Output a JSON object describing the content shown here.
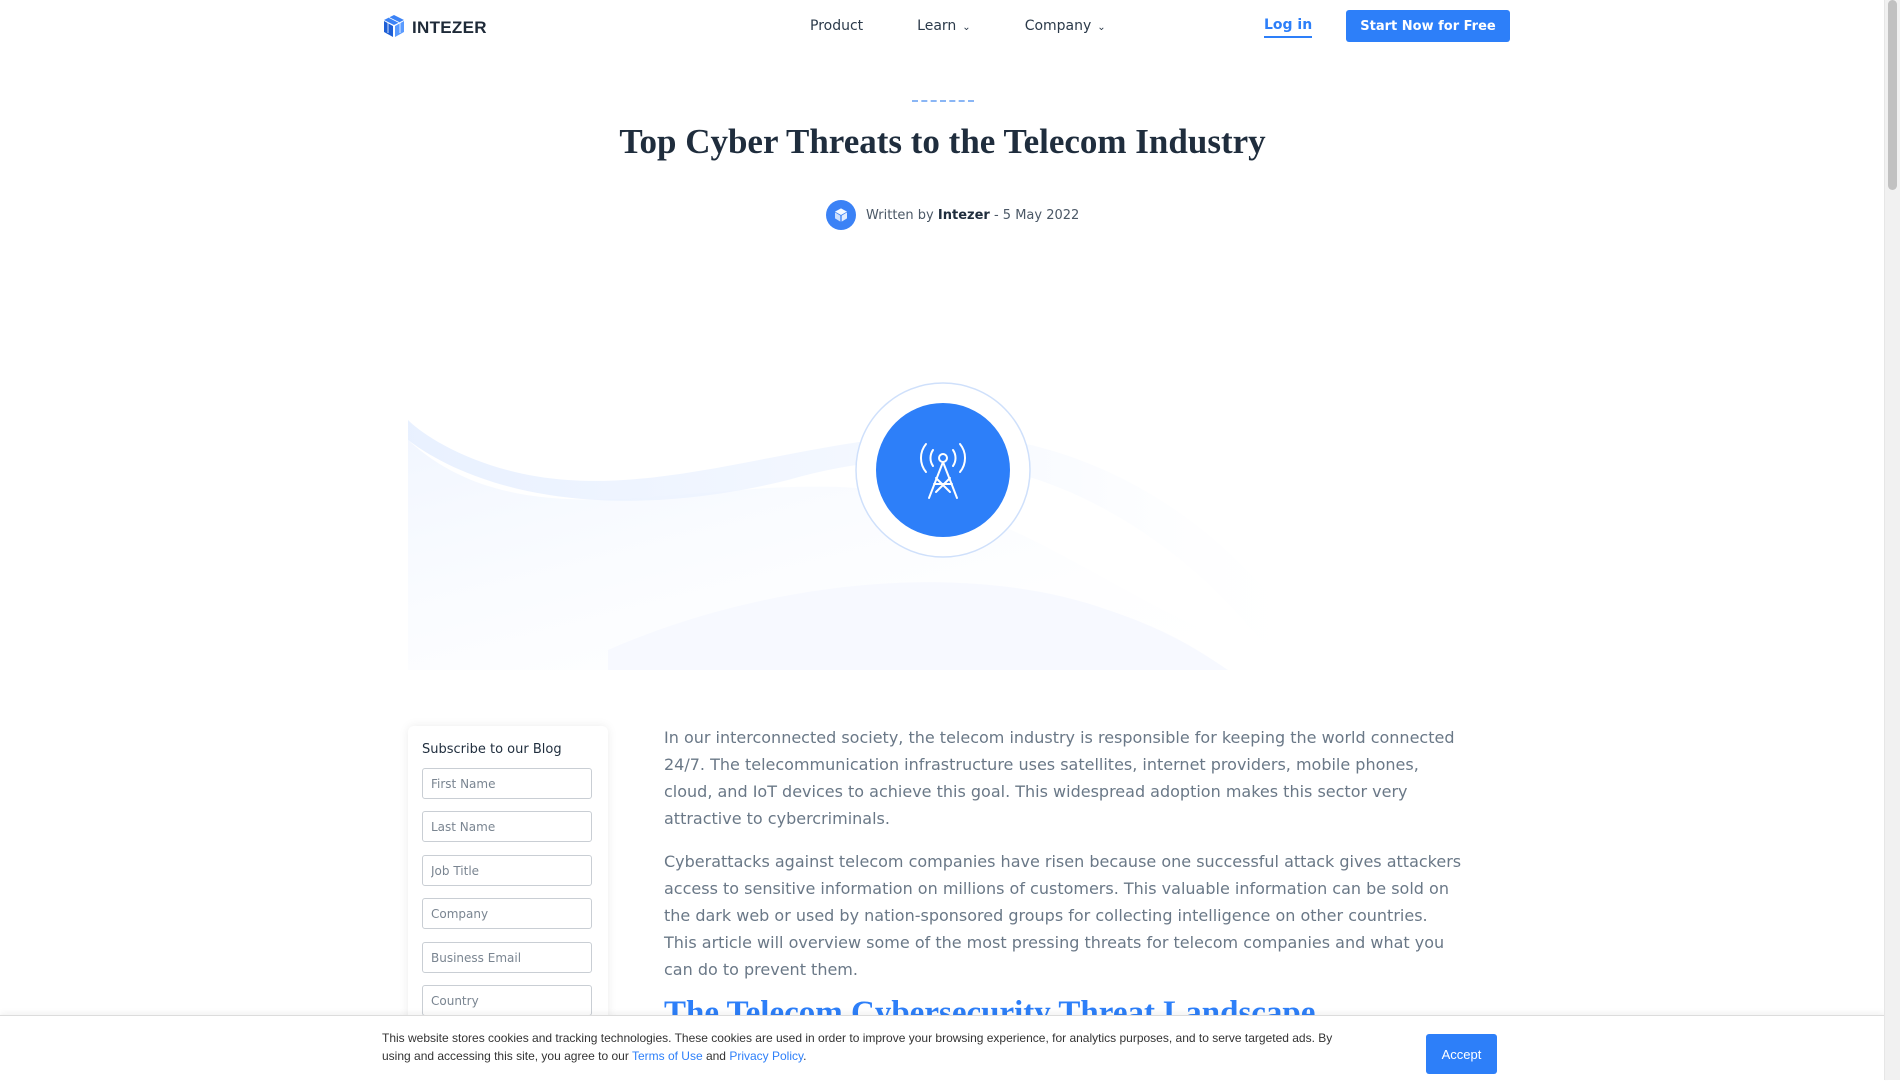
{
  "header": {
    "logo_text": "INTEZER",
    "nav": [
      {
        "label": "Product"
      },
      {
        "label": "Learn"
      },
      {
        "label": "Company"
      }
    ],
    "login_label": "Log in",
    "cta_label": "Start Now for Free"
  },
  "post": {
    "title": "Top Cyber Threats to the Telecom Industry",
    "written_by": "Written by",
    "author": "Intezer",
    "separator": "-",
    "date": "5 May 2022"
  },
  "subscribe": {
    "heading": "Subscribe to our Blog",
    "fields": {
      "first_name": "First Name",
      "last_name": "Last Name",
      "job_title": "Job Title",
      "company": "Company",
      "email": "Business Email",
      "country": "Country"
    }
  },
  "article": {
    "paragraphs": [
      "In our interconnected society, the telecom industry is responsible for keeping the world connected 24/7. The telecommunication infrastructure uses satellites, internet providers, mobile phones, cloud, and IoT devices to achieve this goal. This widespread adoption makes this sector very attractive to cybercriminals.",
      "Cyberattacks against telecom companies have risen because one successful attack gives attackers access to sensitive information on millions of customers. This valuable information can be sold on the dark web or used by nation-sponsored groups for collecting intelligence on other countries. This article will overview some of the most pressing threats for telecom companies and what you can do to prevent them."
    ],
    "partial_heading": "The Telecom Cybersecurity Threat Landscape"
  },
  "cookie": {
    "text_before": "This website stores cookies and tracking technologies. These cookies are used in order to improve your browsing experience, for analytics purposes, and to serve targeted ads. By using and accessing this site, you agree to our ",
    "terms_label": "Terms of Use",
    "and": " and ",
    "privacy_label": "Privacy Policy",
    "period": ".",
    "accept_label": "Accept"
  },
  "colors": {
    "brand_blue": "#2d7ff9",
    "heading": "#1f2d3d",
    "body_text": "#6a7887"
  },
  "icons": [
    "intezer-logo-icon",
    "chevron-down-icon",
    "cell-tower-icon"
  ]
}
